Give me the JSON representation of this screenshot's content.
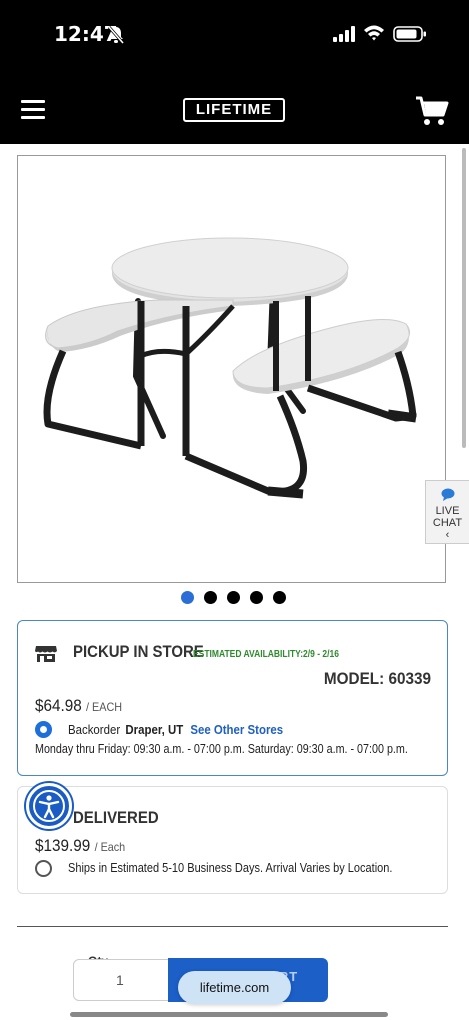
{
  "status_bar": {
    "time": "12:47"
  },
  "header": {
    "logo_text": "LIFETIME"
  },
  "product": {
    "image_alt": "picnic table product image",
    "carousel_dots": 5,
    "active_dot": 0
  },
  "live_chat": {
    "line1": "LIVE",
    "line2": "CHAT",
    "chevron": "‹"
  },
  "pickup": {
    "title": "PICKUP IN STORE",
    "estimated": "ESTIMATED AVAILABILITY:2/9 - 2/16",
    "model": "MODEL: 60339",
    "price": "$64.98",
    "price_unit": "/ EACH",
    "status": "Backorder",
    "location": "Draper, UT",
    "link": "See Other Stores",
    "hours": "Monday thru Friday: 09:30 a.m. - 07:00 p.m. Saturday: 09:30 a.m. - 07:00 p.m."
  },
  "delivery": {
    "title": "DELIVERED",
    "price": "$139.99",
    "price_unit": "/ Each",
    "ships_text": "Ships in Estimated 5-10 Business Days. Arrival Varies by Location."
  },
  "purchase": {
    "qty_label": "Qty",
    "qty_value": "1",
    "add_button": "ADD TO CART"
  },
  "browser": {
    "url": "lifetime.com"
  },
  "colors": {
    "accent_blue": "#1b5fc7",
    "availability_green": "#2f8a2f",
    "link_blue": "#2060c0"
  }
}
